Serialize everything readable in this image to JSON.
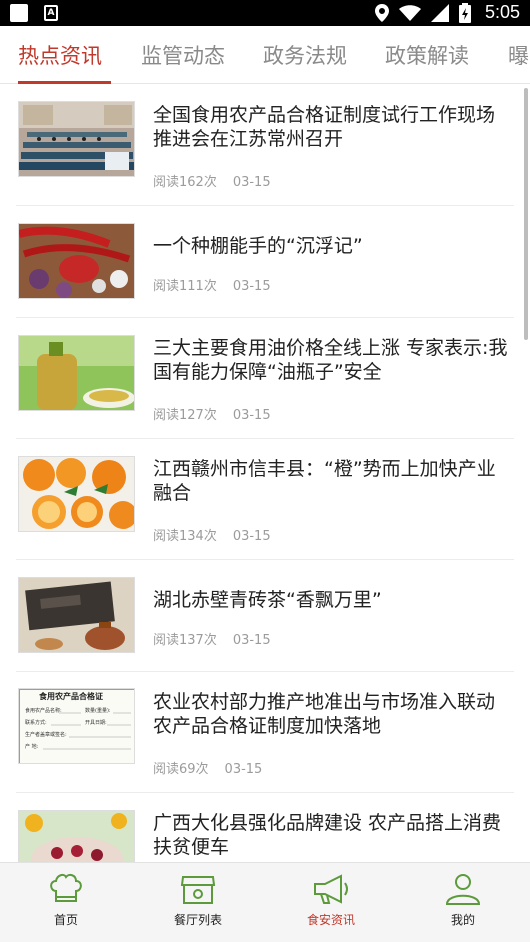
{
  "status_bar": {
    "time": "5:05"
  },
  "tabs": [
    {
      "label": "热点资讯"
    },
    {
      "label": "监管动态"
    },
    {
      "label": "政务法规"
    },
    {
      "label": "政策解读"
    },
    {
      "label": "曝"
    }
  ],
  "articles": [
    {
      "title": "全国食用农产品合格证制度试行工作现场推进会在江苏常州召开",
      "reads": "阅读162次",
      "date": "03-15",
      "thumb": "conference-photo"
    },
    {
      "title": "一个种棚能手的“沉浮记”",
      "reads": "阅读111次",
      "date": "03-15",
      "thumb": "chili-peppers-photo"
    },
    {
      "title": "三大主要食用油价格全线上涨 专家表示:我国有能力保障“油瓶子”安全",
      "reads": "阅读127次",
      "date": "03-15",
      "thumb": "cooking-oil-photo"
    },
    {
      "title": "江西赣州市信丰县：“橙”势而上加快产业融合",
      "reads": "阅读134次",
      "date": "03-15",
      "thumb": "oranges-photo"
    },
    {
      "title": "湖北赤壁青砖茶“香飘万里”",
      "reads": "阅读137次",
      "date": "03-15",
      "thumb": "brick-tea-photo"
    },
    {
      "title": "农业农村部力推产地准出与市场准入联动 农产品合格证制度加快落地",
      "reads": "阅读69次",
      "date": "03-15",
      "thumb": "certificate-photo"
    },
    {
      "title": "广西大化县强化品牌建设 农产品搭上消费扶贫便车",
      "reads": "",
      "date": "",
      "thumb": "fruit-bowl-photo"
    }
  ],
  "certificate": {
    "header": "食用农产品合格证",
    "lines": [
      "食用农产品名称:",
      "联系方式:",
      "生产者盖章或签名:",
      "产  地:"
    ],
    "lines_right": [
      "数量(重量):",
      "开具日期:"
    ]
  },
  "bottom_nav": [
    {
      "label": "首页",
      "icon": "chef-hat-icon"
    },
    {
      "label": "餐厅列表",
      "icon": "storefront-icon"
    },
    {
      "label": "食安资讯",
      "icon": "megaphone-icon"
    },
    {
      "label": "我的",
      "icon": "user-icon"
    }
  ],
  "colors": {
    "accent": "#c0392b",
    "nav_active": "#c0392b"
  }
}
